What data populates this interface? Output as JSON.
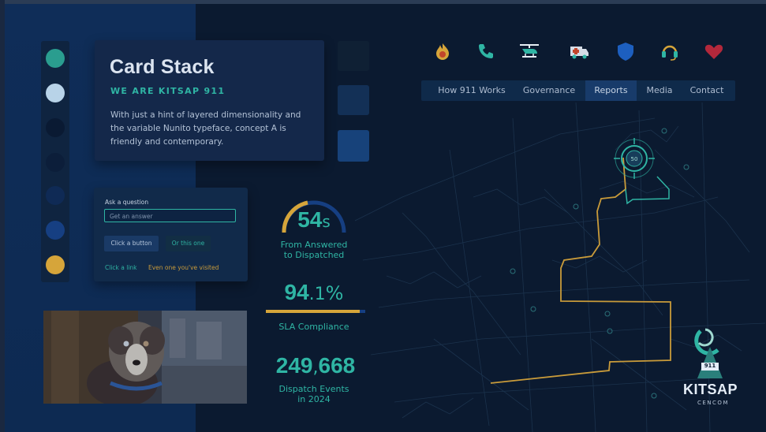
{
  "card": {
    "title": "Card Stack",
    "subtitle": "WE ARE KITSAP 911",
    "body": "With just a hint of layered dimensionality and the variable Nunito typeface, concept A is friendly and contemporary."
  },
  "swatches": [
    "#2a9d8f",
    "#b8d3e8",
    "#0a1a33",
    "#0c1e3a",
    "#0f2a55",
    "#163f82",
    "#d6a53a"
  ],
  "form": {
    "label": "Ask a question",
    "input_placeholder": "Get an answer",
    "primary_button": "Click a button",
    "secondary_button": "Or this one",
    "link": "Click a link",
    "visited_link": "Even one you've visited"
  },
  "stats": {
    "dispatch_time_value": "54",
    "dispatch_time_unit": "s",
    "dispatch_time_label_1": "From Answered",
    "dispatch_time_label_2": "to Dispatched",
    "sla_value_int": "94",
    "sla_value_dec": ".1",
    "sla_unit": "%",
    "sla_label": "SLA Compliance",
    "sla_fraction": 0.941,
    "events_value_a": "249",
    "events_value_sep": ",",
    "events_value_b": "668",
    "events_label_1": "Dispatch Events",
    "events_label_2": "in 2024"
  },
  "icons": [
    "fire-icon",
    "phone-icon",
    "helicopter-icon",
    "ambulance-icon",
    "shield-icon",
    "headset-icon",
    "heart-icon"
  ],
  "nav": [
    "How 911 Works",
    "Governance",
    "Reports",
    "Media",
    "Contact"
  ],
  "nav_active": "Reports",
  "map": {
    "target_label": "50"
  },
  "logo": {
    "badge": "911",
    "name": "KITSAP",
    "sub": "CENCOM"
  },
  "colors": {
    "accent_teal": "#2fb5a4",
    "accent_gold": "#d6a53a",
    "background": "#0b1a30"
  }
}
